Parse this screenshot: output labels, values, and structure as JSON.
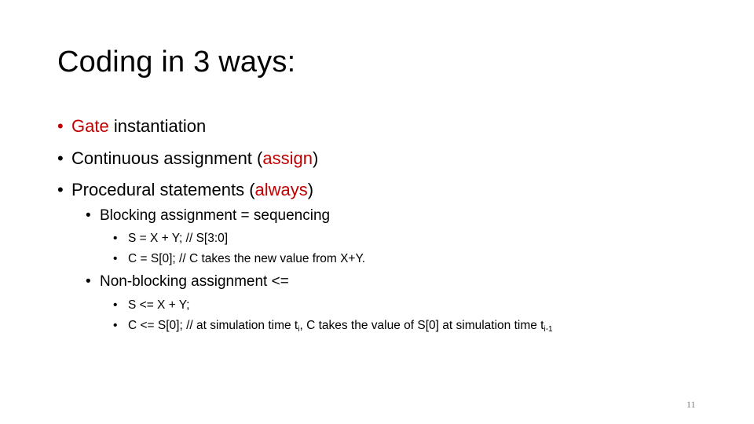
{
  "slide": {
    "title": "Coding in 3 ways:",
    "page_number": "11",
    "accent_color": "#c00000",
    "bullets": [
      {
        "highlight": "Gate",
        "rest": " instantiation"
      },
      {
        "pre": "Continuous assignment (",
        "highlight": "assign",
        "post": ")"
      },
      {
        "pre": "Procedural statements (",
        "highlight": "always",
        "post": ")"
      }
    ],
    "blocking": {
      "heading": "Blocking assignment  =  sequencing",
      "items": [
        "S = X + Y;  // S[3:0]",
        "C = S[0]; // C takes the new value from X+Y."
      ]
    },
    "nonblocking": {
      "heading": "Non-blocking assignment  <=",
      "item1": "S <= X + Y;",
      "item2_a": "C <= S[0]; // at simulation time t",
      "item2_sub1": "i",
      "item2_b": ", C takes the value of S[0] at simulation time t",
      "item2_sub2": "i-1"
    },
    "bullet_glyph": "•"
  }
}
